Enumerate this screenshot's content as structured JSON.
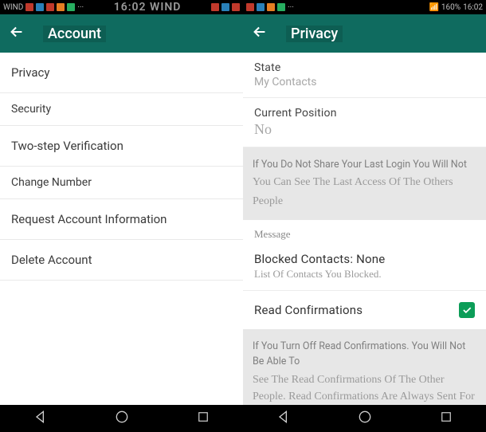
{
  "status": {
    "carrier": "WIND",
    "center_time": "16:02 WIND",
    "battery": "160%",
    "clock": "16:02"
  },
  "left": {
    "header_title": "Account",
    "items": [
      "Privacy",
      "Security",
      "Two-step Verification",
      "Change Number",
      "Request Account Information",
      "Delete Account"
    ]
  },
  "right": {
    "header_title": "Privacy",
    "state_label": "State",
    "state_value": "My Contacts",
    "pos_label": "Current Position",
    "pos_value": "No",
    "info1_a": "If You Do Not Share Your Last Login You Will Not",
    "info1_b": "You Can See The Last Access Of The Others",
    "info1_c": "People",
    "message_label": "Message",
    "blocked_title": "Blocked Contacts: None",
    "blocked_sub": "List Of Contacts You Blocked.",
    "readconf_label": "Read Confirmations",
    "readconf_checked": true,
    "info2_a": "If You Turn Off Read Confirmations. You Will Not Be Able To",
    "info2_b": "See The Read Confirmations Of The Other People. Read Confirmations Are Always Sent For Group Chats."
  },
  "colors": {
    "header": "#0f6b5f",
    "accent": "#0c9d58"
  }
}
